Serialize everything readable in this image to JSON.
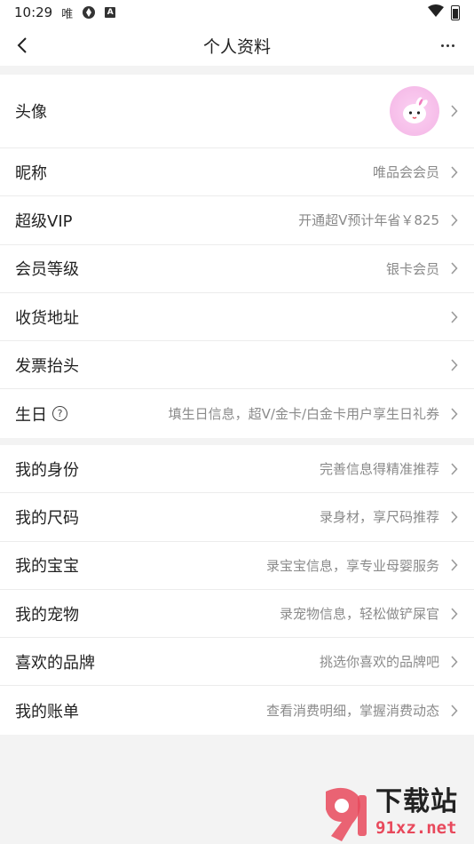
{
  "status_bar": {
    "time": "10:29",
    "indicator_char": "唯",
    "icons": [
      "app-indicator-icon",
      "sync-icon",
      "app-a-icon",
      "wifi-icon",
      "battery-icon"
    ]
  },
  "header": {
    "title": "个人资料",
    "back_icon": "back-arrow-icon",
    "more_icon": "more-dots-icon"
  },
  "profile_section": [
    {
      "label": "头像",
      "value": "",
      "type": "avatar"
    },
    {
      "label": "昵称",
      "value": "唯品会会员"
    },
    {
      "label": "超级VIP",
      "value": "开通超V预计年省￥825"
    },
    {
      "label": "会员等级",
      "value": "银卡会员"
    },
    {
      "label": "收货地址",
      "value": ""
    },
    {
      "label": "发票抬头",
      "value": ""
    },
    {
      "label": "生日",
      "value": "填生日信息，超V/金卡/白金卡用户享生日礼券",
      "help_icon": "question-circle-icon"
    }
  ],
  "personal_section": [
    {
      "label": "我的身份",
      "value": "完善信息得精准推荐"
    },
    {
      "label": "我的尺码",
      "value": "录身材，享尺码推荐"
    },
    {
      "label": "我的宝宝",
      "value": "录宝宝信息，享专业母婴服务"
    },
    {
      "label": "我的宠物",
      "value": "录宠物信息，轻松做铲屎官"
    },
    {
      "label": "喜欢的品牌",
      "value": "挑选你喜欢的品牌吧"
    },
    {
      "label": "我的账单",
      "value": "查看消费明细，掌握消费动态"
    }
  ],
  "watermark": {
    "title": "下载站",
    "url": "91xz.net"
  },
  "colors": {
    "background": "#f3f3f3",
    "card": "#ffffff",
    "value_text": "#8a8a8a",
    "avatar_bg": "#f6bde9",
    "watermark_accent": "#e8495c"
  }
}
